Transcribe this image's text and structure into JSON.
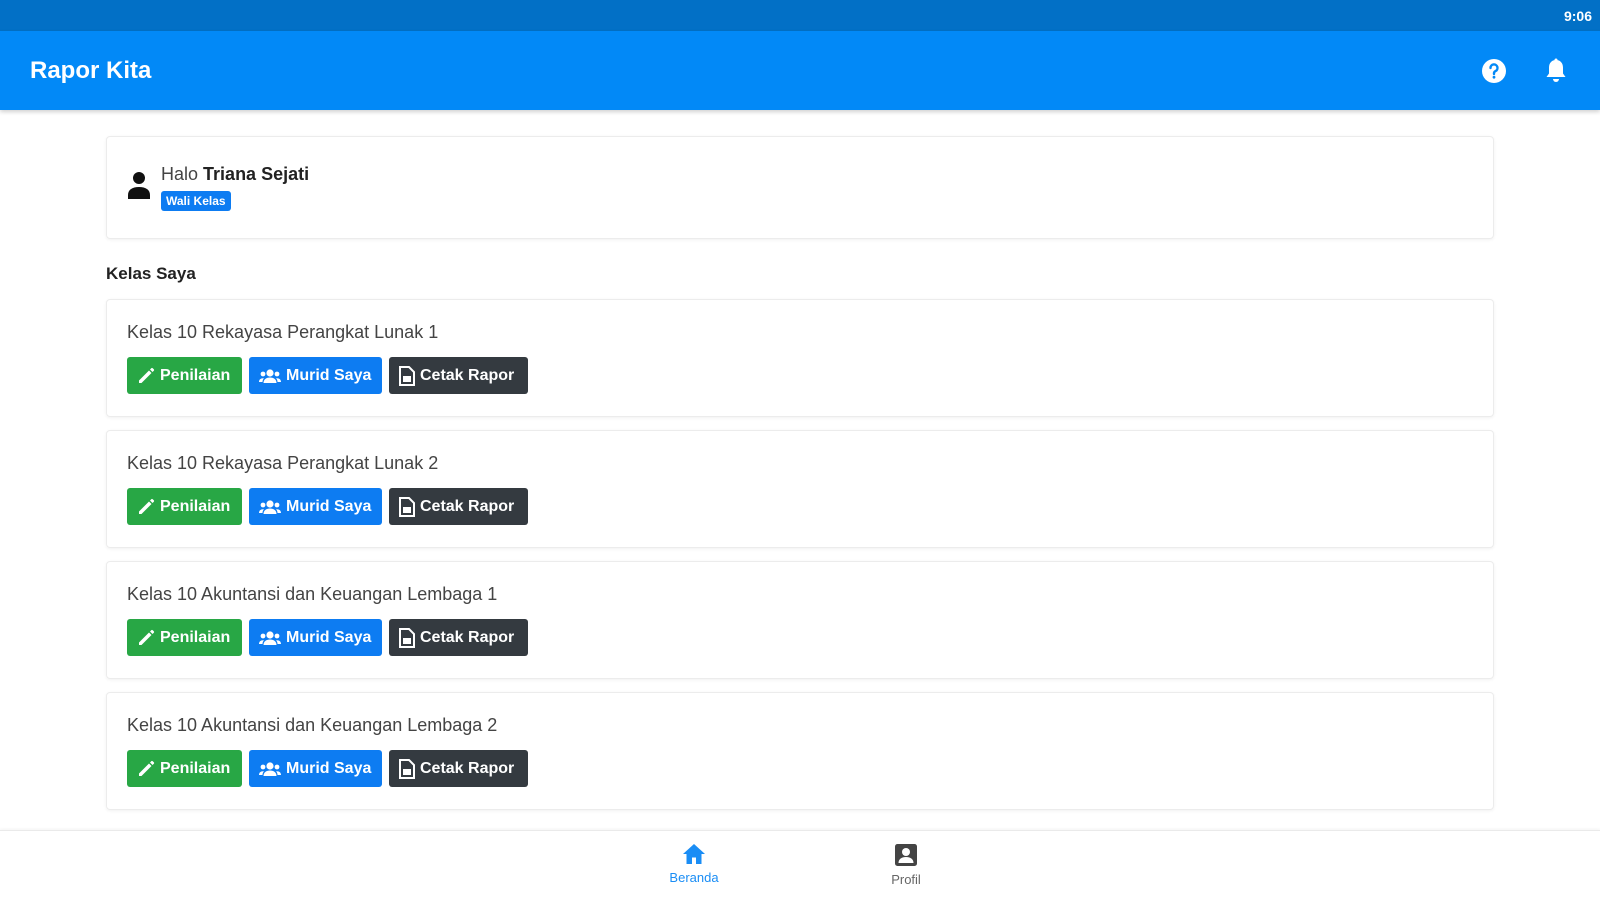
{
  "status_bar": {
    "time": "9:06"
  },
  "app_bar": {
    "title": "Rapor Kita",
    "icons": [
      "help-circle-icon",
      "bell-icon"
    ]
  },
  "greeting": {
    "prefix": "Halo",
    "name": "Triana Sejati",
    "role": "Wali Kelas"
  },
  "section_title": "Kelas Saya",
  "buttons": {
    "assessment": "Penilaian",
    "students": "Murid Saya",
    "print": "Cetak Rapor"
  },
  "classes": [
    {
      "name": "Kelas 10 Rekayasa Perangkat Lunak 1"
    },
    {
      "name": "Kelas 10 Rekayasa Perangkat Lunak 2"
    },
    {
      "name": "Kelas 10 Akuntansi dan Keuangan Lembaga 1"
    },
    {
      "name": "Kelas 10 Akuntansi dan Keuangan Lembaga 2"
    }
  ],
  "bottom_nav": {
    "items": [
      {
        "label": "Beranda",
        "icon": "home-icon",
        "active": true
      },
      {
        "label": "Profil",
        "icon": "profile-card-icon",
        "active": false
      }
    ]
  },
  "colors": {
    "status_bar": "#0270c6",
    "app_bar": "#0289f7",
    "green": "#28a745",
    "blue": "#0d7cf2",
    "dark": "#343a40",
    "active_nav": "#1a8df5"
  }
}
